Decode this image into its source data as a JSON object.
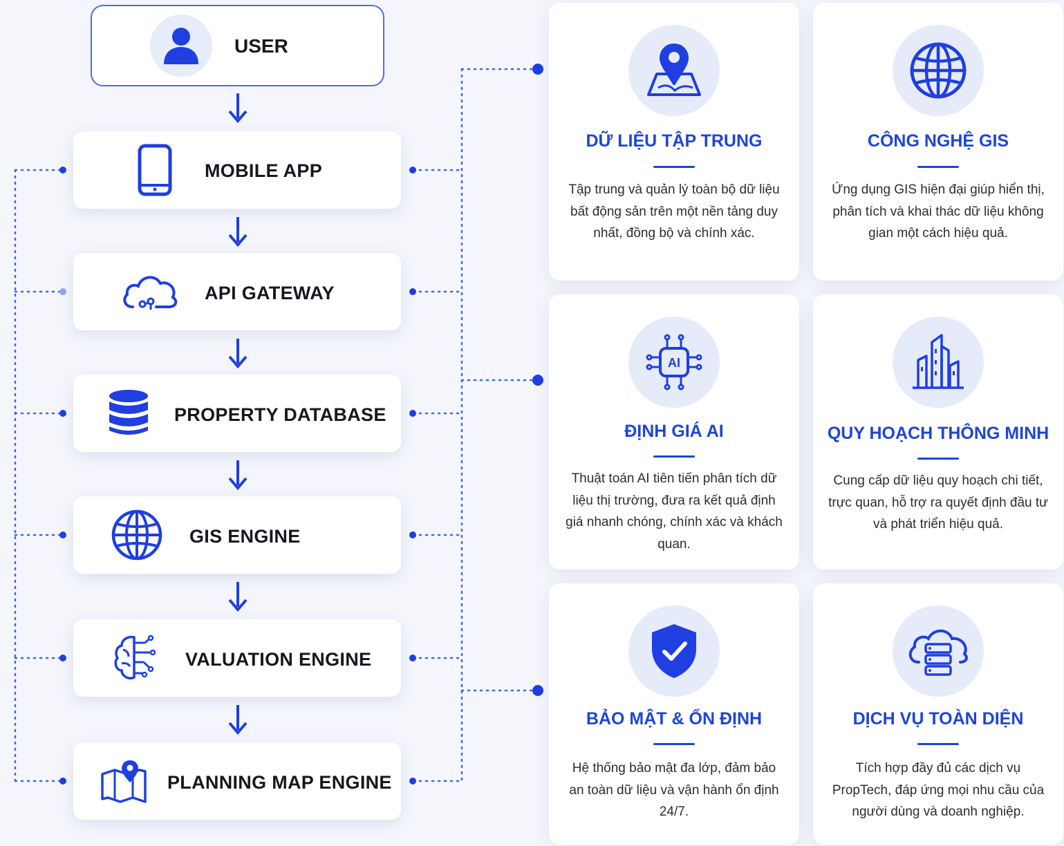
{
  "flow": {
    "user_label": "USER",
    "steps": [
      {
        "label": "MOBILE APP",
        "icon": "smartphone-icon"
      },
      {
        "label": "API GATEWAY",
        "icon": "cloud-api-icon"
      },
      {
        "label": "PROPERTY DATABASE",
        "icon": "database-icon"
      },
      {
        "label": "GIS ENGINE",
        "icon": "globe-icon"
      },
      {
        "label": "VALUATION ENGINE",
        "icon": "brain-circuit-icon"
      },
      {
        "label": "PLANNING MAP ENGINE",
        "icon": "map-pin-icon"
      }
    ]
  },
  "features": [
    {
      "title": "DỮ LIỆU TẬP TRUNG",
      "icon": "location-map-icon",
      "description": "Tập trung và quản lý toàn bộ dữ liệu bất động sản trên một nền tảng duy nhất, đồng bộ và chính xác."
    },
    {
      "title": "CÔNG NGHỆ GIS",
      "icon": "globe-icon",
      "description": "Ứng dụng GIS hiện đại giúp hiển thị, phân tích và khai thác dữ liệu không gian một cách hiệu quả."
    },
    {
      "title": "ĐỊNH GIÁ AI",
      "icon": "ai-chip-icon",
      "description": "Thuật toán AI tiên tiến phân tích dữ liệu thị trường, đưa ra kết quả định giá nhanh chóng, chính xác và khách quan."
    },
    {
      "title": "QUY HOẠCH THÔNG MINH",
      "icon": "city-buildings-icon",
      "description": "Cung cấp dữ liệu quy hoạch chi tiết, trực quan, hỗ trợ ra quyết định đầu tư và phát triển hiệu quả."
    },
    {
      "title": "BẢO MẬT & ỔN ĐỊNH",
      "icon": "shield-check-icon",
      "description": "Hệ thống bảo mật đa lớp, đảm bảo an toàn dữ liệu và vận hành ổn định 24/7."
    },
    {
      "title": "DỊCH VỤ TOÀN DIỆN",
      "icon": "cloud-server-icon",
      "description": "Tích hợp đầy đủ các dịch vụ PropTech, đáp ứng mọi nhu cầu của người dùng và doanh nghiệp."
    }
  ],
  "colors": {
    "accent": "#1d45d8",
    "icon_blue": "#1f3fe0",
    "connector": "#3f63e6",
    "background": "#f4f6fb"
  }
}
